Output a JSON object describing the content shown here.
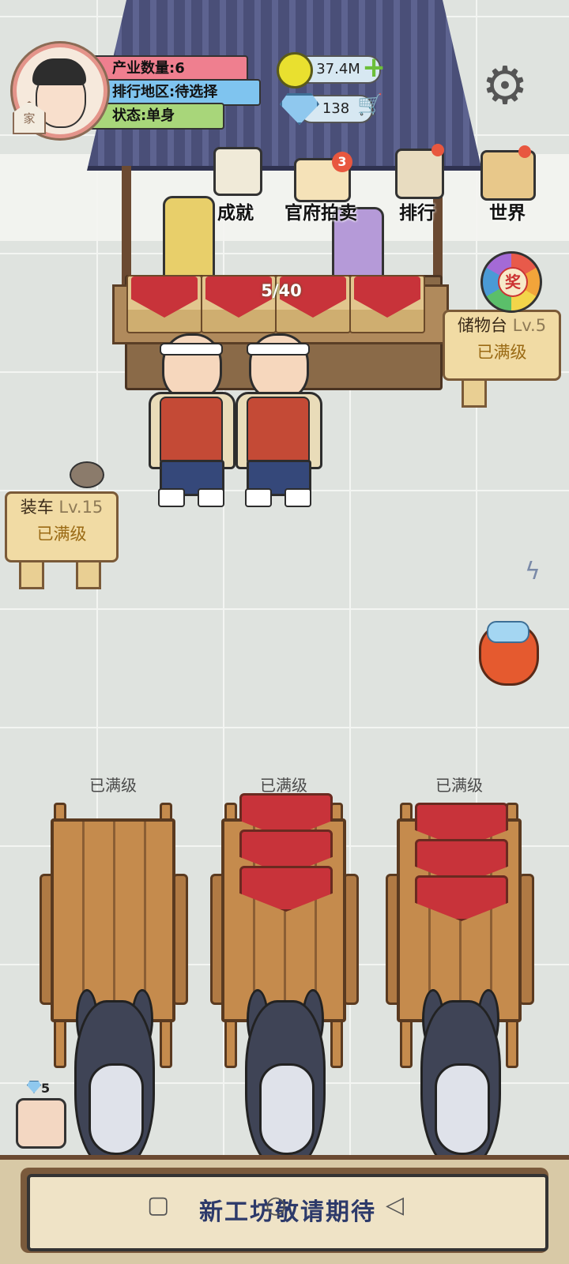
{
  "hud": {
    "home_label": "家",
    "industry_count_label": "产业数量:",
    "industry_count_value": "6",
    "region_label": "排行地区:",
    "region_value": "待选择",
    "status_label": "状态:",
    "status_value": "单身",
    "coins": "37.4M",
    "diamonds": "138"
  },
  "top_menu": [
    {
      "label": "成就"
    },
    {
      "label": "官府拍卖",
      "badge": "3"
    },
    {
      "label": "排行"
    },
    {
      "label": "世界"
    }
  ],
  "counter": {
    "progress_text": "5/40"
  },
  "prize_wheel_label": "奖",
  "storage_sign": {
    "name": "储物台",
    "level": "Lv.5",
    "status": "已满级"
  },
  "loading_sign": {
    "name": "装车",
    "level": "Lv.15",
    "status": "已满级"
  },
  "carts": [
    {
      "label": "已满级",
      "loads": 0
    },
    {
      "label": "已满级",
      "loads": 3
    },
    {
      "label": "已满级",
      "loads": 3
    }
  ],
  "shop": {
    "gem_count": "5"
  },
  "bottom_banner": "新工坊敬请期待",
  "icons": [
    "gear-icon",
    "coin-icon",
    "diamond-icon",
    "plus-icon",
    "cart-icon",
    "prize-wheel-icon",
    "money-bag-icon"
  ],
  "colors": {
    "roof": "#4a4f78",
    "crate_red": "#c8333a",
    "sign_bg": "#f1dba4",
    "bottom_text": "#2d3a6a"
  }
}
